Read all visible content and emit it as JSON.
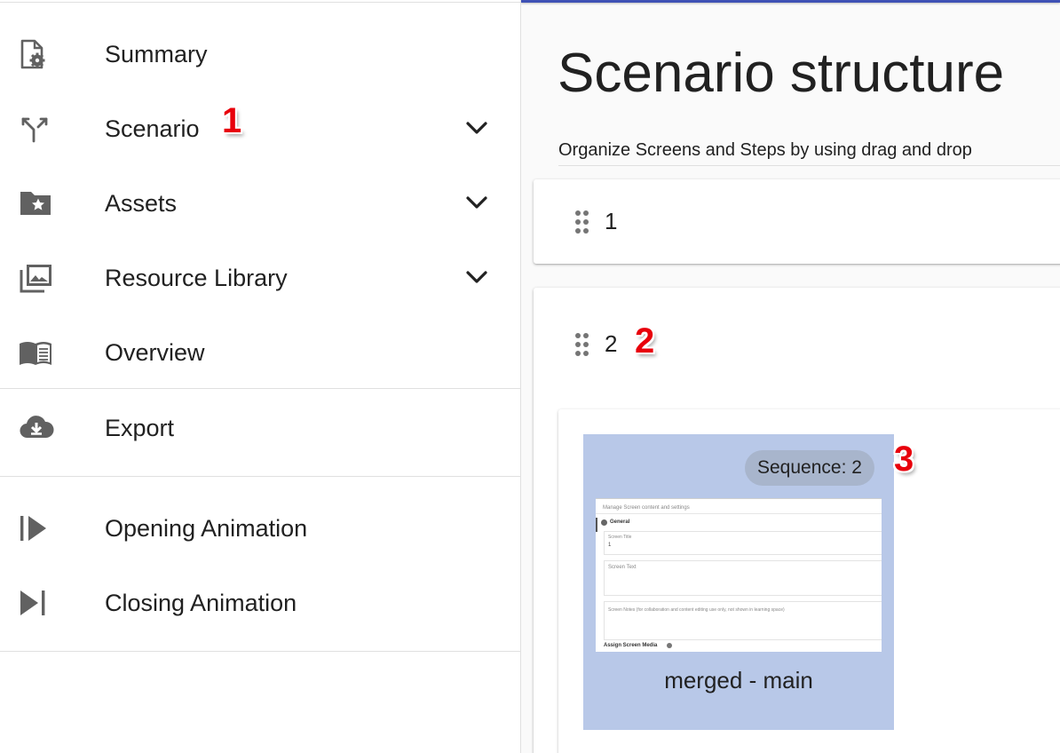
{
  "sidebar": {
    "items": [
      {
        "label": "Summary",
        "icon": "file-gear-icon"
      },
      {
        "label": "Scenario",
        "icon": "call-split-icon",
        "expandable": true
      },
      {
        "label": "Assets",
        "icon": "folder-star-icon",
        "expandable": true
      },
      {
        "label": "Resource Library",
        "icon": "photo-library-icon",
        "expandable": true
      },
      {
        "label": "Overview",
        "icon": "book-open-icon"
      },
      {
        "label": "Export",
        "icon": "cloud-download-icon"
      },
      {
        "label": "Opening Animation",
        "icon": "skip-start-icon"
      },
      {
        "label": "Closing Animation",
        "icon": "skip-end-icon"
      }
    ]
  },
  "annotations": [
    "1",
    "2",
    "3"
  ],
  "main": {
    "title": "Scenario structure",
    "subtitle": "Organize Screens and Steps by using drag and drop",
    "sequences": [
      {
        "number": "1"
      },
      {
        "number": "2",
        "screens": [
          {
            "chip": "Sequence: 2",
            "title": "merged - main",
            "thumbnail": {
              "header": "Manage Screen content and settings",
              "section": "General",
              "field1_label": "Screen Title",
              "field1_value": "1",
              "field2_label": "Screen Text",
              "field3_text": "Screen Notes (for collaboration and content editing use only, not shown in learning space)",
              "footer": "Assign Screen Media"
            }
          }
        ]
      }
    ]
  },
  "colors": {
    "accent": "#3f51b5",
    "tile_bg": "#b8c8e8",
    "chip_bg": "#a8b5cc",
    "annotation": "#e8000b",
    "icon": "#616161"
  }
}
